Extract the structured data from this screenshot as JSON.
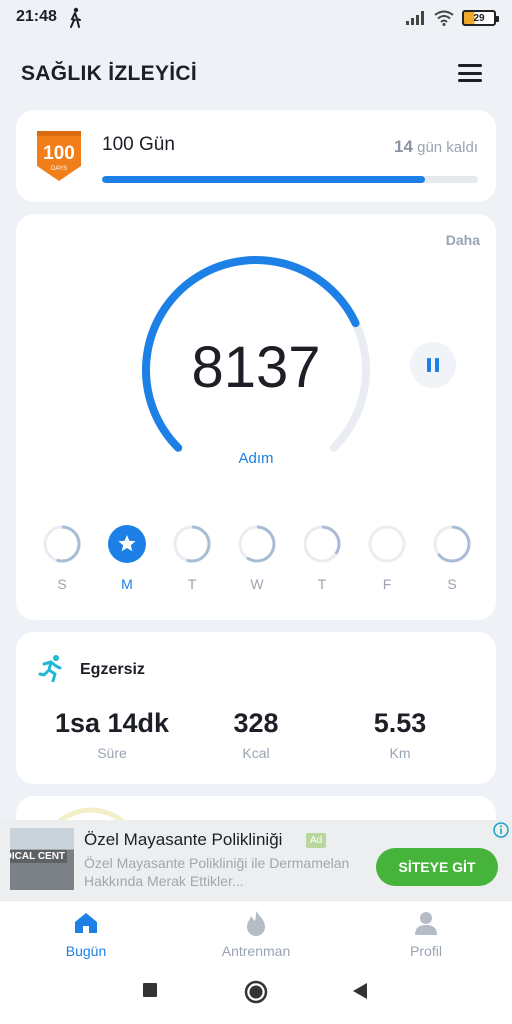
{
  "status_bar": {
    "time": "21:48",
    "battery": "29",
    "icons": [
      "walking-icon",
      "signal-icon",
      "wifi-icon",
      "battery-icon"
    ]
  },
  "header": {
    "title": "SAĞLIK İZLEYİCİ",
    "menu_icon": "hamburger-menu-icon"
  },
  "challenge": {
    "badge_number": "100",
    "badge_text": "DAYS",
    "title": "100 Gün",
    "remaining_number": "14",
    "remaining_text": "gün kaldı",
    "progress_fraction": 0.86
  },
  "steps": {
    "more_link": "Daha",
    "value": "8137",
    "label": "Adım",
    "goal_fraction": 0.74,
    "pause_icon": "pause-icon"
  },
  "week": {
    "days": [
      {
        "letter": "S",
        "fraction": 0.55,
        "active": false
      },
      {
        "letter": "M",
        "fraction": 1.0,
        "active": true
      },
      {
        "letter": "T",
        "fraction": 0.55,
        "active": false
      },
      {
        "letter": "W",
        "fraction": 0.6,
        "active": false
      },
      {
        "letter": "T",
        "fraction": 0.35,
        "active": false
      },
      {
        "letter": "F",
        "fraction": 0.0,
        "active": false
      },
      {
        "letter": "S",
        "fraction": 0.65,
        "active": false
      }
    ]
  },
  "exercise": {
    "title": "Egzersiz",
    "icon": "running-icon",
    "stats": [
      {
        "value": "1sa 14dk",
        "label": "Süre"
      },
      {
        "value": "328",
        "label": "Kcal"
      },
      {
        "value": "5.53",
        "label": "Km"
      }
    ]
  },
  "ad": {
    "thumb_text": "EDICAL CENT",
    "title": "Özel Mayasante Polikliniği",
    "tag": "Ad",
    "description": "Özel Mayasante Polikliniği ile Dermamelan Hakkında Merak Ettikler...",
    "cta": "SİTEYE GİT",
    "info_icon": "info-icon"
  },
  "bottom_nav": {
    "items": [
      {
        "label": "Bugün",
        "icon": "home-icon",
        "active": true
      },
      {
        "label": "Antrenman",
        "icon": "flame-icon",
        "active": false
      },
      {
        "label": "Profil",
        "icon": "person-icon",
        "active": false
      }
    ]
  },
  "system_nav": {
    "buttons": [
      "recents-square-icon",
      "home-circle-icon",
      "back-triangle-icon"
    ]
  },
  "colors": {
    "accent": "#1d80e6",
    "ring_track": "#e9ecf1",
    "background": "#eef1f5",
    "cta_green": "#46b43a",
    "badge_orange": "#f07e1a"
  }
}
